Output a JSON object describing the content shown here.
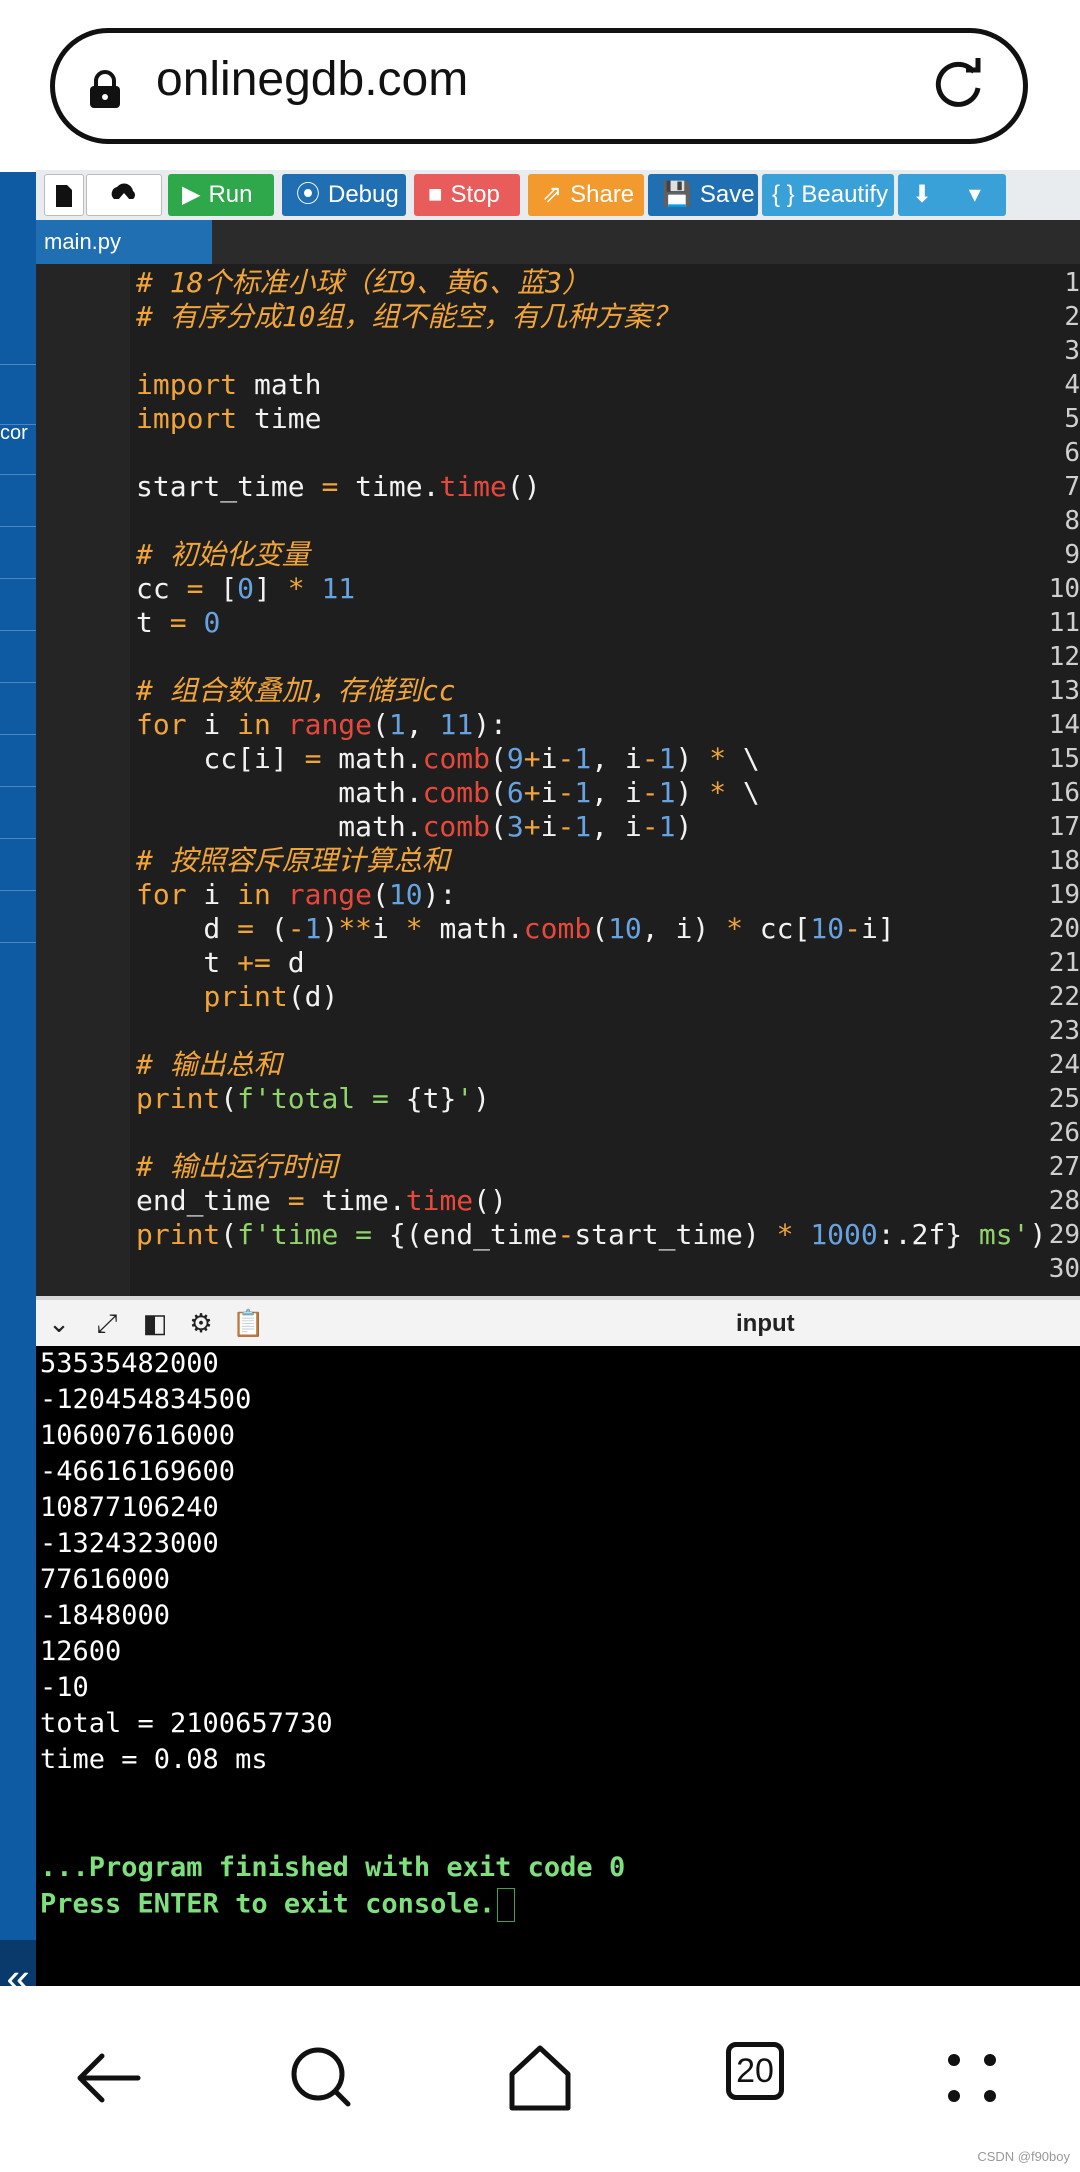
{
  "browser": {
    "url": "onlinegdb.com",
    "open_tabs": "20"
  },
  "sidebar": {
    "partial_label": "cor"
  },
  "toolbar": {
    "run": "Run",
    "debug": "Debug",
    "stop": "Stop",
    "share": "Share",
    "save": "Save",
    "beautify": "{ } Beautify"
  },
  "tabs": {
    "active": "main.py"
  },
  "code_lines": [
    "1",
    "2",
    "3",
    "4",
    "5",
    "6",
    "7",
    "8",
    "9",
    "10",
    "11",
    "12",
    "13",
    "14",
    "15",
    "16",
    "17",
    "18",
    "19",
    "20",
    "21",
    "22",
    "23",
    "24",
    "25",
    "26",
    "27",
    "28",
    "29",
    "30"
  ],
  "code_text": {
    "l1": "# 18个标准小球（红9、黄6、蓝3）",
    "l2": "# 有序分成10组，组不能空，有几种方案？",
    "l9": "# 初始化变量",
    "l13": "# 组合数叠加，存储到cc",
    "l18": "# 按照容斥原理计算总和",
    "l24": "# 输出总和",
    "l27": "# 输出运行时间"
  },
  "console": {
    "input_label": "input",
    "output": [
      "53535482000",
      "-120454834500",
      "106007616000",
      "-46616169600",
      "10877106240",
      "-1324323000",
      "77616000",
      "-1848000",
      "12600",
      "-10",
      "total = 2100657730",
      "time = 0.08 ms"
    ],
    "finished": "...Program finished with exit code 0",
    "press_enter": "Press ENTER to exit console."
  },
  "watermark": "CSDN @f90boy",
  "colors": {
    "run": "#2ea84a",
    "debug": "#1f6fb2",
    "stop": "#e85c5c",
    "share": "#f29a2e",
    "save": "#1f6fb2",
    "beautify": "#3aa0d8"
  }
}
